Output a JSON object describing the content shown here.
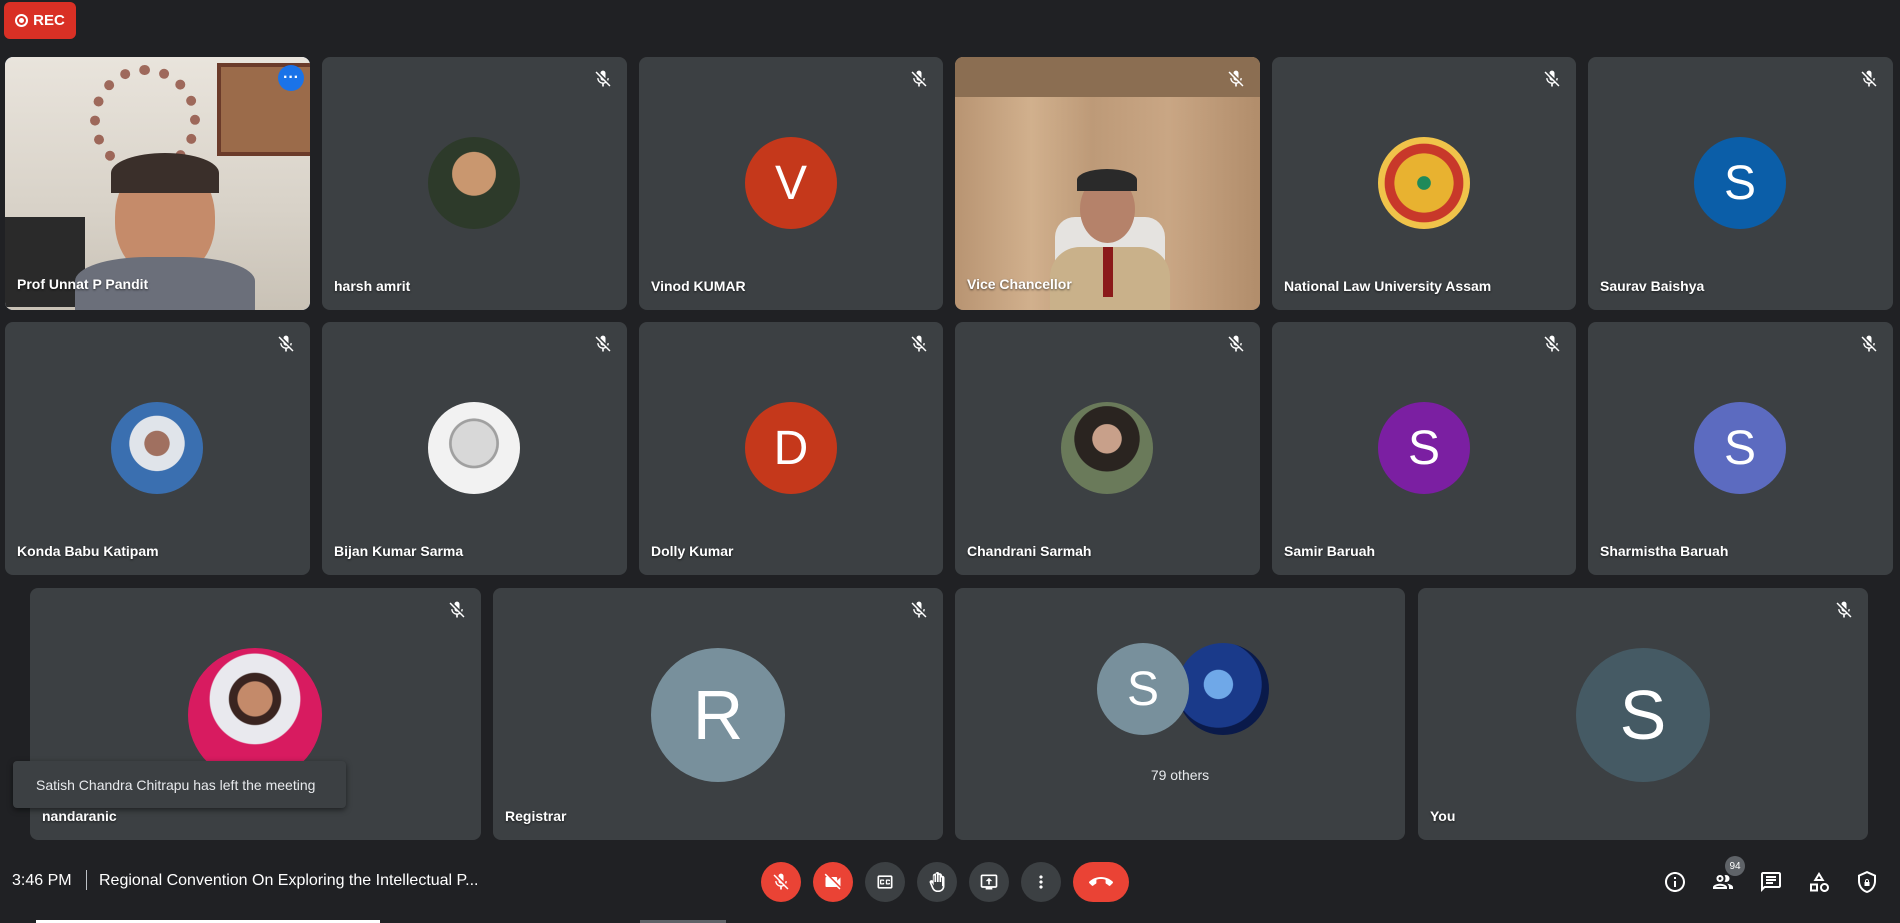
{
  "recording": {
    "label": "REC"
  },
  "participants": [
    {
      "name": "Prof Unnat P Pandit"
    },
    {
      "name": "harsh amrit"
    },
    {
      "name": "Vinod KUMAR",
      "initial": "V",
      "color": "#c5381b"
    },
    {
      "name": "Vice Chancellor"
    },
    {
      "name": "National Law University Assam"
    },
    {
      "name": "Saurav Baishya",
      "initial": "S",
      "color": "#0b5ea8"
    },
    {
      "name": "Konda Babu Katipam"
    },
    {
      "name": "Bijan Kumar Sarma"
    },
    {
      "name": "Dolly Kumar",
      "initial": "D",
      "color": "#c5381b"
    },
    {
      "name": "Chandrani Sarmah"
    },
    {
      "name": "Samir Baruah",
      "initial": "S",
      "color": "#7b1fa2"
    },
    {
      "name": "Sharmistha Baruah",
      "initial": "S",
      "color": "#5c6bc0"
    },
    {
      "name": "nandaranic"
    },
    {
      "name": "Registrar",
      "initial": "R",
      "color": "#78909c"
    },
    {
      "name": "79 others",
      "initial": "S",
      "color": "#78909c"
    },
    {
      "name": "You",
      "initial": "S",
      "color": "#455a64"
    }
  ],
  "toast": {
    "message": "Satish Chandra Chitrapu has left the meeting"
  },
  "bottom_bar": {
    "time": "3:46 PM",
    "meeting_title": "Regional Convention On Exploring the Intellectual P...",
    "people_count": "94"
  }
}
